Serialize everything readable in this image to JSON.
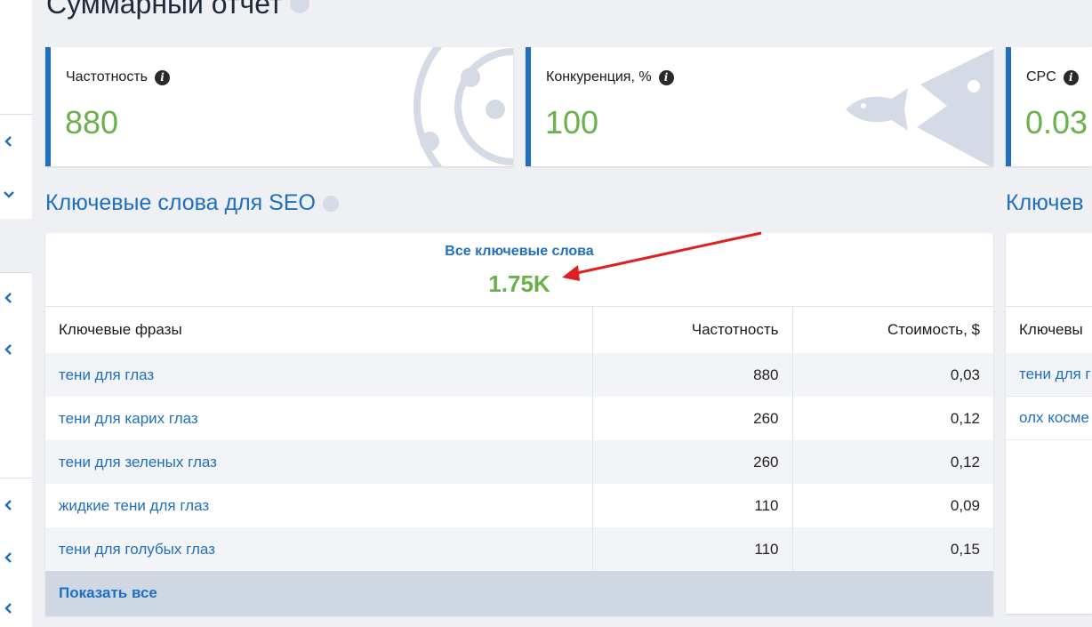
{
  "page": {
    "title": "Суммарный отчет"
  },
  "cards": [
    {
      "label": "Частотность",
      "value": "880"
    },
    {
      "label": "Конкуренция, %",
      "value": "100"
    },
    {
      "label": "CPC",
      "value": "0.03"
    }
  ],
  "seo": {
    "title": "Ключевые слова для SEO",
    "all_keywords_label": "Все ключевые слова",
    "all_keywords_value": "1.75K",
    "columns": [
      "Ключевые фразы",
      "Частотность",
      "Стоимость, $"
    ],
    "rows": [
      {
        "phrase": "тени для глаз",
        "freq": "880",
        "cost": "0,03"
      },
      {
        "phrase": "тени для карих глаз",
        "freq": "260",
        "cost": "0,12"
      },
      {
        "phrase": "тени для зеленых глаз",
        "freq": "260",
        "cost": "0,12"
      },
      {
        "phrase": "жидкие тени для глаз",
        "freq": "110",
        "cost": "0,09"
      },
      {
        "phrase": "тени для голубых глаз",
        "freq": "110",
        "cost": "0,15"
      }
    ],
    "show_all": "Показать все"
  },
  "right_panel": {
    "title": "Ключев",
    "column": "Ключевы",
    "rows": [
      "тени для г",
      "олх косме"
    ]
  },
  "colors": {
    "accent": "#1f6fc0",
    "value_green": "#6ab04c",
    "annotation_arrow": "#e02020"
  },
  "icons": {
    "info": "i",
    "sidebar_chevrons": [
      "chevron-left-icon",
      "chevron-down-icon",
      "chevron-left-icon",
      "chevron-left-icon",
      "chevron-left-icon",
      "chevron-left-icon",
      "chevron-left-icon"
    ]
  }
}
